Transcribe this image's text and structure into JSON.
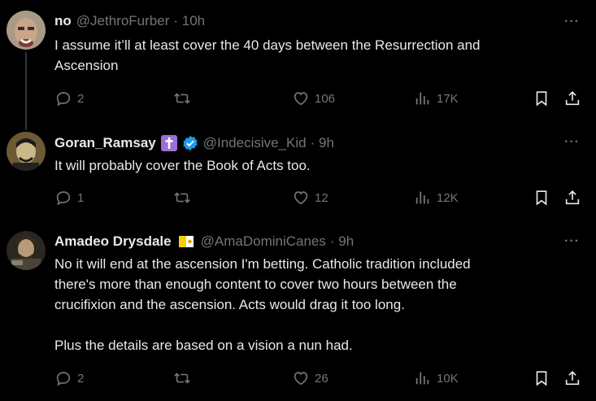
{
  "tweets": [
    {
      "name": "no",
      "handle": "@JethroFurber",
      "time": "· 10h",
      "text": "I assume it’ll at least cover the 40 days between the Resurrection and\nAscension",
      "replies": "2",
      "likes": "106",
      "views": "17K"
    },
    {
      "name": "Goran_Ramsay",
      "handle": "@Indecisive_Kid",
      "time": "· 9h",
      "text": "It will probably cover the Book of Acts too.",
      "replies": "1",
      "likes": "12",
      "views": "12K"
    },
    {
      "name": "Amadeo Drysdale",
      "handle": "@AmaDominiCanes",
      "time": "· 9h",
      "text": "No it will end at the ascension I'm betting. Catholic tradition included\nthere's more than enough content to cover two hours between the\ncrucifixion and the ascension. Acts would drag it too long.\n\nPlus the details are based on a vision a nun had.",
      "replies": "2",
      "likes": "26",
      "views": "10K"
    }
  ],
  "colors": {
    "background": "#000000",
    "text": "#e7e9ea",
    "muted": "#71767b",
    "verified": "#1d9bf0",
    "cross_badge": "#9a6fd6",
    "vatican_badge": "#f5d000"
  },
  "icons": [
    "reply-icon",
    "retweet-icon",
    "like-icon",
    "views-icon",
    "bookmark-icon",
    "share-icon",
    "more-icon",
    "verified-icon",
    "cross-emoji-icon",
    "vatican-flag-icon"
  ]
}
